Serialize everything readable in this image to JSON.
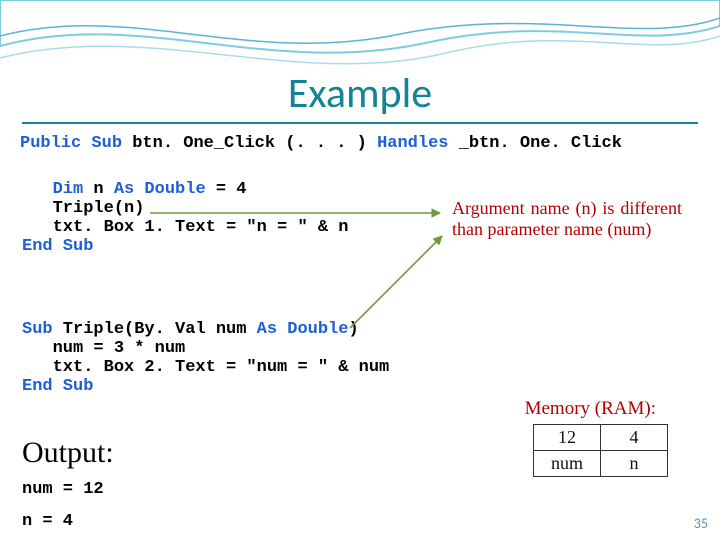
{
  "title": "Example",
  "code": {
    "sig_pre": "Public Sub",
    "sig_name": " btn. One_Click (. . . ) ",
    "sig_handles": "Handles",
    "sig_post": " _btn. One. Click",
    "dim": "Dim",
    "n_decl_mid": " n ",
    "as_double": "As Double",
    "eq4": " = 4",
    "triple_call": "   Triple(n)",
    "txt1": "   txt. Box 1. Text = \"n = \" & n",
    "endsub": "End Sub",
    "sub": "Sub",
    "triple_sig_mid": " Triple(By. Val num ",
    "close_paren": ")",
    "mul": "   num = 3 * num",
    "txt2": "   txt. Box 2. Text = \"num = \" & num"
  },
  "callout": "Argument name (n) is different than parameter name (num)",
  "memory": {
    "label": "Memory (RAM):",
    "cells": [
      {
        "val": "12",
        "name": "num"
      },
      {
        "val": "4",
        "name": "n"
      }
    ]
  },
  "output": {
    "heading": "Output:",
    "lines": [
      "num = 12",
      "n = 4"
    ]
  },
  "slide_number": "35"
}
